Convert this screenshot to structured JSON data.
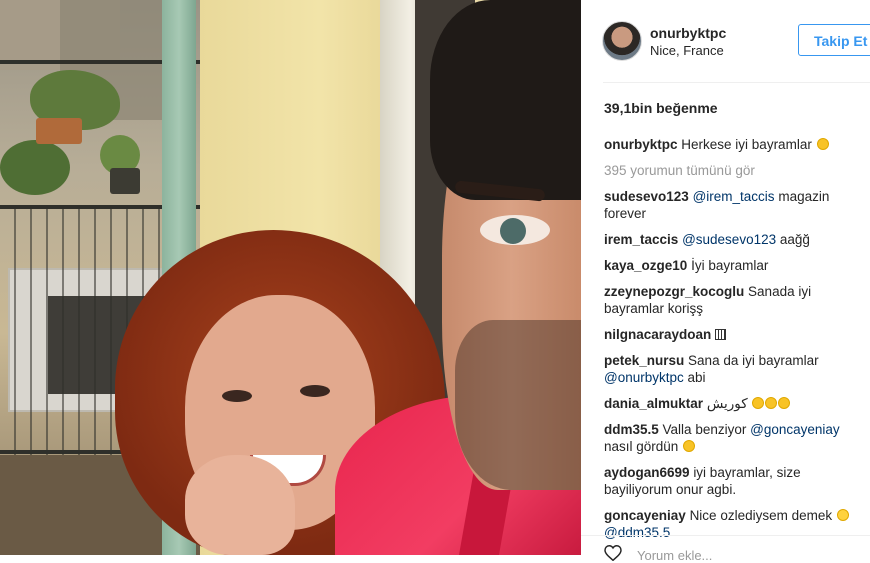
{
  "post": {
    "username": "onurbyktpc",
    "location": "Nice, France",
    "follow_label": "Takip Et",
    "likes": "39,1bin beğenme",
    "caption": {
      "user": "onurbyktpc",
      "text": "Herkese iyi bayramlar"
    },
    "view_all": "395 yorumun tümünü gör",
    "comments": [
      {
        "user": "sudesevo123",
        "mention": "@irem_taccis",
        "text": "magazin forever"
      },
      {
        "user": "irem_taccis",
        "mention": "@sudesevo123",
        "text": "aağğ"
      },
      {
        "user": "kaya_ozge10",
        "text": "İyi bayramlar"
      },
      {
        "user": "zzeynepozgr_kocoglu",
        "text": "Sanada iyi bayramlar korişş"
      },
      {
        "user": "nilgnacaraydoan",
        "text": ""
      },
      {
        "user": "petek_nursu",
        "text": "Sana da iyi bayramlar",
        "mention": "@onurbyktpc",
        "text2": "abi"
      },
      {
        "user": "dania_almuktar",
        "text": "كوريش"
      },
      {
        "user": "ddm35.5",
        "text": "Valla benziyor",
        "mention": "@goncayeniay",
        "text2": "nasıl gördün"
      },
      {
        "user": "aydogan6699",
        "text": "iyi bayramlar, size bayiliyorum onur agbi."
      },
      {
        "user": "goncayeniay",
        "text": "Nice ozlediysem demek",
        "mention": "@ddm35.5"
      }
    ],
    "add_comment_placeholder": "Yorum ekle..."
  },
  "icons": {
    "avatar": "profile-photo",
    "heart": "heart-outline-icon",
    "emoji": "smiley-emoji-icon",
    "box": "unknown-glyph-icon"
  },
  "colors": {
    "follow_blue": "#3897f0",
    "mention_blue": "#003569",
    "muted": "#999999"
  }
}
